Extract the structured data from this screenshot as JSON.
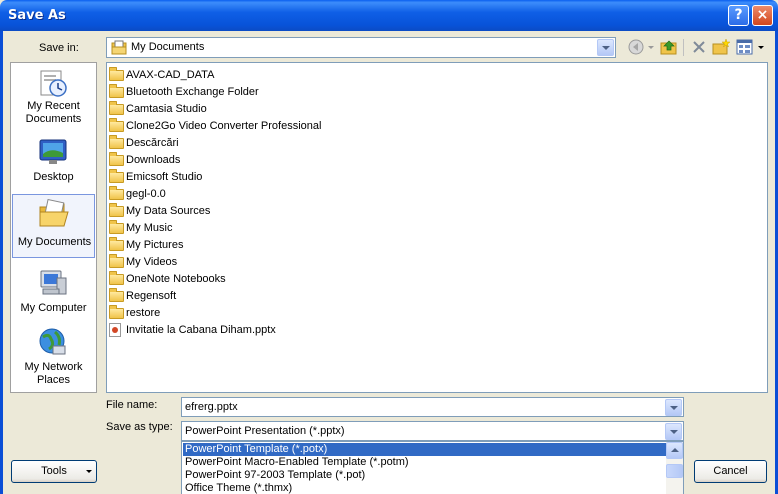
{
  "window": {
    "title": "Save As",
    "help_symbol": "?",
    "close_symbol": "×"
  },
  "save_in": {
    "label": "Save in:",
    "value": "My Documents"
  },
  "toolbar": {
    "icons": [
      "back-icon",
      "up-folder-icon",
      "delete-icon",
      "new-folder-icon",
      "views-icon"
    ]
  },
  "places": [
    {
      "label_lines": [
        "My Recent",
        "Documents"
      ],
      "icon": "recent-documents-icon"
    },
    {
      "label_lines": [
        "Desktop"
      ],
      "icon": "desktop-icon"
    },
    {
      "label_lines": [
        "My Documents"
      ],
      "icon": "my-documents-icon",
      "selected": true
    },
    {
      "label_lines": [
        "My Computer"
      ],
      "icon": "my-computer-icon"
    },
    {
      "label_lines": [
        "My Network",
        "Places"
      ],
      "icon": "network-places-icon"
    }
  ],
  "files": [
    {
      "name": "AVAX-CAD_DATA",
      "type": "folder"
    },
    {
      "name": "Bluetooth Exchange Folder",
      "type": "folder"
    },
    {
      "name": "Camtasia Studio",
      "type": "folder"
    },
    {
      "name": "Clone2Go Video Converter Professional",
      "type": "folder"
    },
    {
      "name": "Descărcări",
      "type": "folder"
    },
    {
      "name": "Downloads",
      "type": "folder"
    },
    {
      "name": "Emicsoft Studio",
      "type": "folder"
    },
    {
      "name": "gegl-0.0",
      "type": "folder"
    },
    {
      "name": "My Data Sources",
      "type": "folder"
    },
    {
      "name": "My Music",
      "type": "folder"
    },
    {
      "name": "My Pictures",
      "type": "folder"
    },
    {
      "name": "My Videos",
      "type": "folder"
    },
    {
      "name": "OneNote Notebooks",
      "type": "folder"
    },
    {
      "name": "Regensoft",
      "type": "folder"
    },
    {
      "name": "restore",
      "type": "folder"
    },
    {
      "name": "Invitatie la Cabana Diham.pptx",
      "type": "pptx"
    }
  ],
  "file_name": {
    "label": "File name:",
    "value": "efrerg.pptx"
  },
  "save_as_type": {
    "label": "Save as type:",
    "value": "PowerPoint Presentation (*.pptx)",
    "options": [
      {
        "label": "PowerPoint Template (*.potx)",
        "selected": true
      },
      {
        "label": "PowerPoint Macro-Enabled Template (*.potm)"
      },
      {
        "label": "PowerPoint 97-2003 Template (*.pot)"
      },
      {
        "label": "Office Theme (*.thmx)"
      }
    ]
  },
  "buttons": {
    "tools": "Tools",
    "cancel": "Cancel"
  }
}
